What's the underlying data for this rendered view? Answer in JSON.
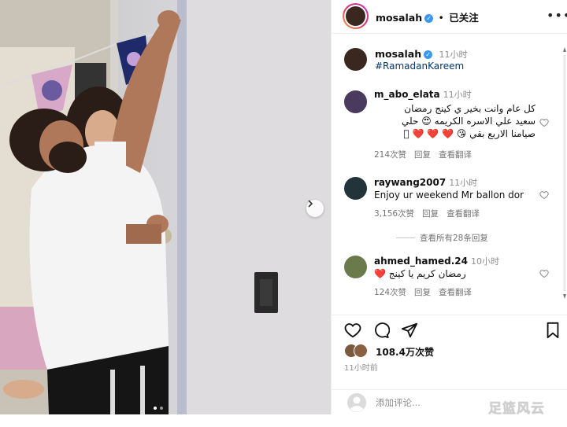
{
  "header": {
    "username": "mosalah",
    "follow_state": "已关注",
    "menu_icon": "more-horizontal-icon"
  },
  "post": {
    "username": "mosalah",
    "time": "11小时",
    "hashtag": "#RamadanKareem"
  },
  "comments": [
    {
      "username": "m_abo_elata",
      "time": "11小时",
      "lines": [
        "كل عام وانت بخير ي كينج رمضان",
        "سعيد علي الاسره الكريمه 😍 حلي",
        "صيامنا الاربع بقي 😘 ❤️ ❤️ ❤️ 🏻"
      ],
      "likes": "214次赞",
      "reply": "回复",
      "translate": "查看翻译"
    },
    {
      "username": "raywang2007",
      "time": "11小时",
      "lines": [
        "Enjoy ur weekend Mr ballon dor"
      ],
      "likes": "3,156次赞",
      "reply": "回复",
      "translate": "查看翻译",
      "view_replies": "查看所有28条回复"
    },
    {
      "username": "ahmed_hamed.24",
      "time": "10小时",
      "lines": [
        "😍 😍",
        "❤️ رمضان كريم يا كينج"
      ],
      "likes": "124次赞",
      "reply": "回复",
      "translate": "查看翻译"
    }
  ],
  "actions": {
    "like_count": "108.4万次赞",
    "posted": "11小时前"
  },
  "composer": {
    "placeholder": "添加评论..."
  },
  "watermark": "足篮风云",
  "carousel": {
    "slides": 2,
    "current": 1
  },
  "colors": {
    "verified": "#3897f0",
    "hashtag": "#00376b",
    "wall": "#d8d8d8",
    "shirt": "#f4f4f4"
  }
}
